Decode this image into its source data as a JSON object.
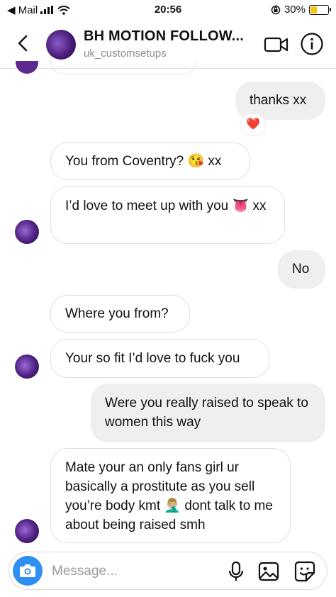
{
  "status": {
    "carrier": "◀ Mail",
    "time": "20:56",
    "battery": "30%"
  },
  "header": {
    "title": "BH MOTION FOLLOW...",
    "subtitle": "uk_customsetups"
  },
  "messages": [
    {
      "id": "m1",
      "side": "out",
      "text": "thanks xx",
      "reaction": "❤️"
    },
    {
      "id": "m2",
      "side": "in",
      "text": "You from Coventry? 😘 xx"
    },
    {
      "id": "m3",
      "side": "in",
      "text": "I’d love to meet up with you 👅 xx"
    },
    {
      "id": "m4",
      "side": "out",
      "text": "No"
    },
    {
      "id": "m5",
      "side": "in",
      "text": "Where you from?"
    },
    {
      "id": "m6",
      "side": "in",
      "text": "Your so fit I’d love to fuck you"
    },
    {
      "id": "m7",
      "side": "out",
      "text": "Were you really raised to speak to women this way"
    },
    {
      "id": "m8",
      "side": "in",
      "text": "Mate your an only fans girl ur basically a prostitute as you sell you’re body kmt 🤦🏼‍♂️ dont talk to me about being raised smh"
    }
  ],
  "composer": {
    "placeholder": "Message..."
  },
  "colors": {
    "camera_button": "#2f8ff0",
    "outgoing_bubble": "#efefef",
    "incoming_border": "#e0e0e0"
  }
}
